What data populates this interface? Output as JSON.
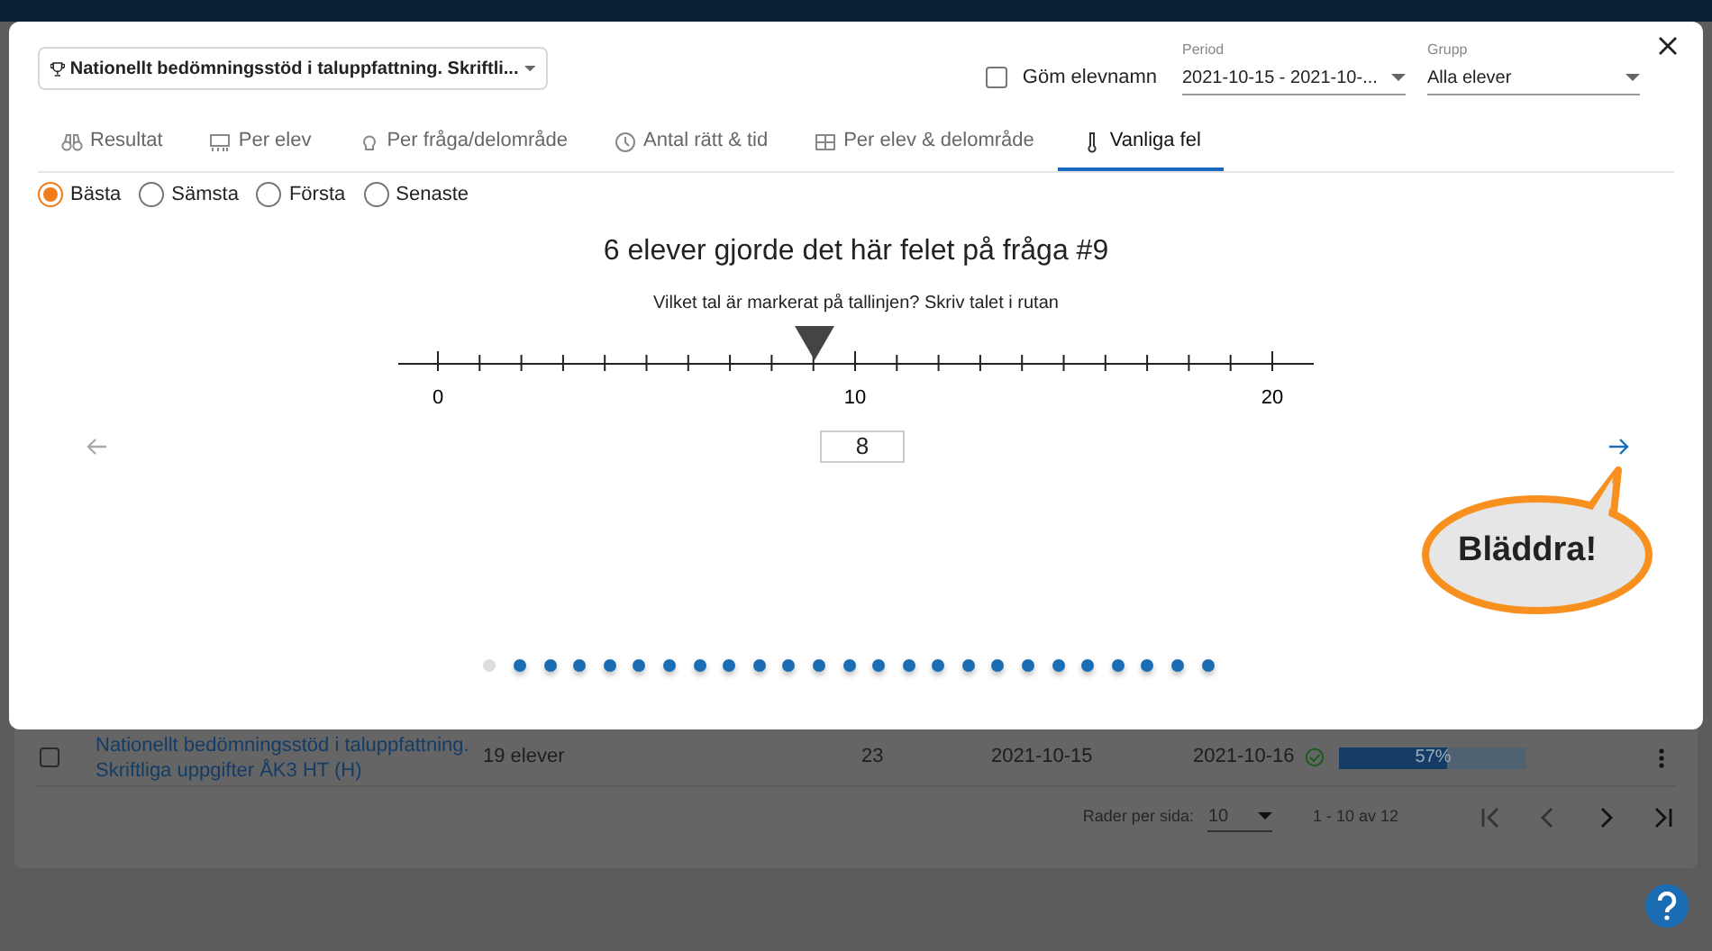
{
  "test_select": {
    "value": "Nationellt bedömningsstöd i taluppfattning. Skriftli..."
  },
  "hide_names": {
    "label": "Göm elevnamn",
    "checked": false
  },
  "period": {
    "label": "Period",
    "value": "2021-10-15 - 2021-10-..."
  },
  "group": {
    "label": "Grupp",
    "value": "Alla elever"
  },
  "tabs": [
    {
      "label": "Resultat",
      "kind": "binoculars",
      "selected": false
    },
    {
      "label": "Per elev",
      "kind": "people",
      "selected": false
    },
    {
      "label": "Per fråga/delområde",
      "kind": "bulb",
      "selected": false
    },
    {
      "label": "Antal rätt & tid",
      "kind": "clock",
      "selected": false
    },
    {
      "label": "Per elev & delområde",
      "kind": "grid",
      "selected": false
    },
    {
      "label": "Vanliga fel",
      "kind": "thermometer",
      "selected": true
    }
  ],
  "sort_options": [
    {
      "label": "Bästa",
      "selected": true
    },
    {
      "label": "Sämsta",
      "selected": false
    },
    {
      "label": "Första",
      "selected": false
    },
    {
      "label": "Senaste",
      "selected": false
    }
  ],
  "heading": "6 elever gjorde det här felet på fråga #9",
  "question": "Vilket tal är markerat på tallinjen? Skriv talet i rutan",
  "number_line_labels": [
    "0",
    "10",
    "20"
  ],
  "answer": "8",
  "callout": "Bläddra!",
  "pager_dots": [
    {
      "selected": true
    },
    {
      "selected": false
    },
    {
      "selected": false
    },
    {
      "selected": false
    },
    {
      "selected": false
    },
    {
      "selected": false
    },
    {
      "selected": false
    },
    {
      "selected": false
    },
    {
      "selected": false
    },
    {
      "selected": false
    },
    {
      "selected": false
    },
    {
      "selected": false
    },
    {
      "selected": false
    },
    {
      "selected": false
    },
    {
      "selected": false
    },
    {
      "selected": false
    },
    {
      "selected": false
    },
    {
      "selected": false
    },
    {
      "selected": false
    },
    {
      "selected": false
    },
    {
      "selected": false
    },
    {
      "selected": false
    },
    {
      "selected": false
    },
    {
      "selected": false
    },
    {
      "selected": false
    }
  ],
  "background_table": {
    "row": {
      "checked": false,
      "title": "Nationellt bedömningsstöd i taluppfattning. Skriftliga uppgifter ÅK3 HT (H)",
      "students": "19 elever",
      "count": "23",
      "start": "2021-10-15",
      "end": "2021-10-16",
      "level": 0.57,
      "progress_label": "57%"
    },
    "rows_per_page_label": "Rader per sida:",
    "rows_per_page": "10",
    "range": "1 - 10 av 12"
  }
}
